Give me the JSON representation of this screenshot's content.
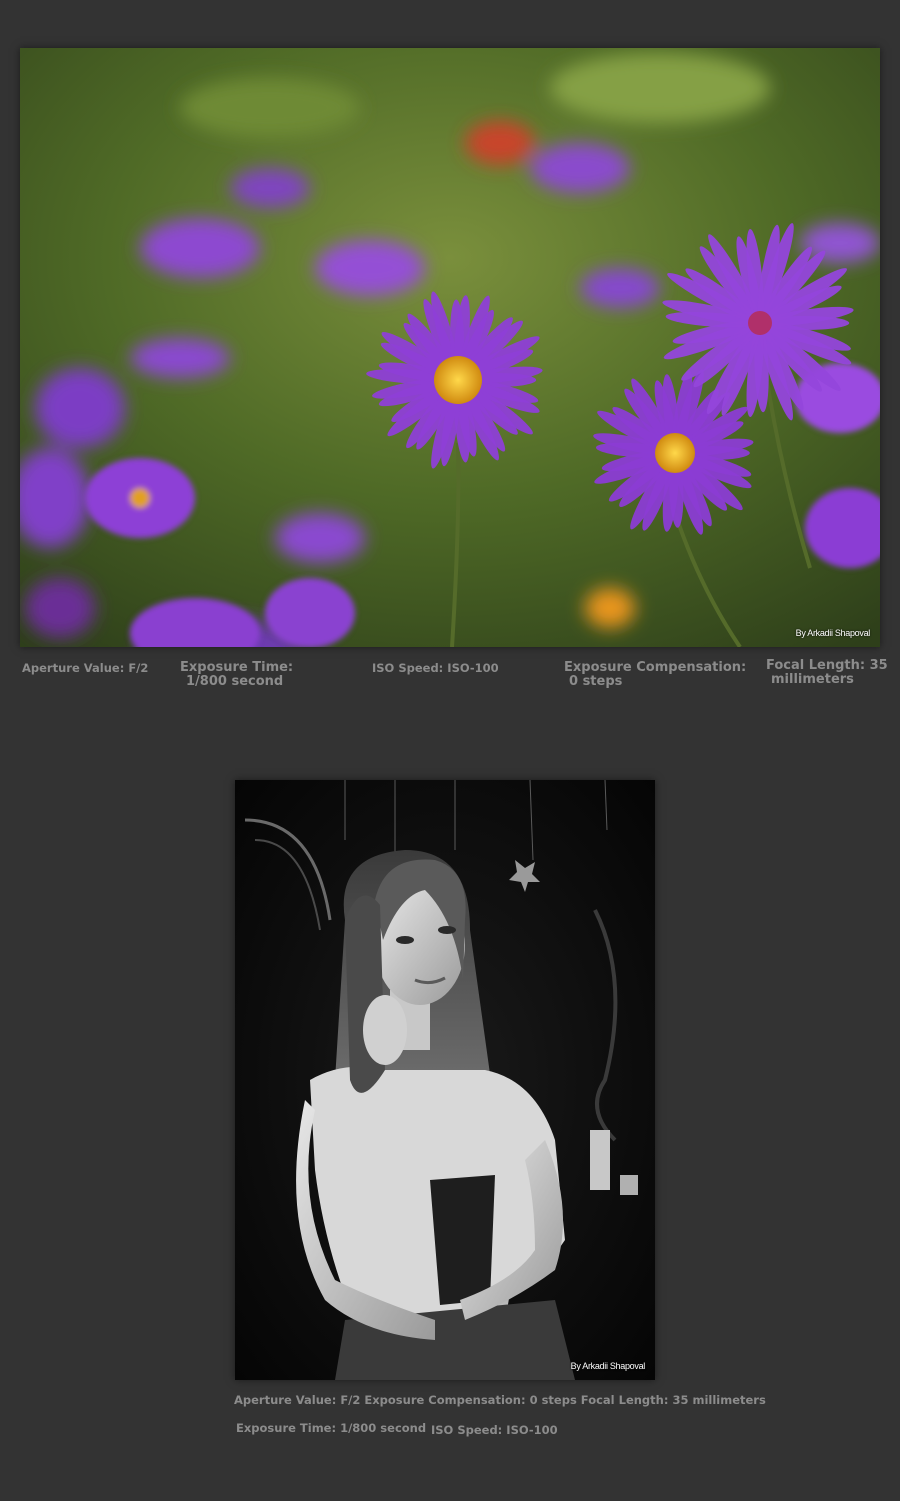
{
  "photo1": {
    "credit": "By Arkadii Shapoval",
    "exif": {
      "aperture": "Aperture Value: F/2",
      "exposure_time_label": "Exposure Time:",
      "exposure_time_value": "1/800 second",
      "iso": "ISO Speed: ISO-100",
      "exposure_comp_label": "Exposure Compensation:",
      "exposure_comp_value": "0 steps",
      "focal_label": "Focal Length: 35",
      "focal_value": "millimeters"
    },
    "colors": {
      "petal": "#8e3fd6",
      "center": "#f2b51c",
      "background": "#5a7a2a"
    }
  },
  "photo2": {
    "credit": "By Arkadii Shapoval",
    "exif": {
      "line1": "Aperture Value: F/2 Exposure Compensation: 0 steps Focal Length: 35 millimeters",
      "exposure_time": "Exposure Time: 1/800 second",
      "iso": "ISO Speed: ISO-100"
    }
  },
  "page": {
    "background": "#333333",
    "text_color": "#8c8c8c"
  }
}
